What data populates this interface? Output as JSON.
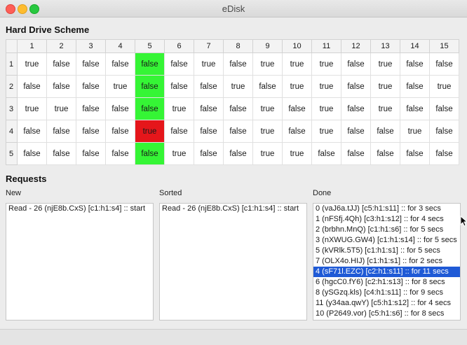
{
  "window": {
    "title": "eDisk"
  },
  "scheme": {
    "title": "Hard Drive Scheme",
    "columns": [
      "1",
      "2",
      "3",
      "4",
      "5",
      "6",
      "7",
      "8",
      "9",
      "10",
      "11",
      "12",
      "13",
      "14",
      "15"
    ],
    "rows": [
      {
        "label": "1",
        "cells": [
          "true",
          "false",
          "false",
          "false",
          "false",
          "false",
          "true",
          "false",
          "true",
          "true",
          "true",
          "false",
          "true",
          "false",
          "false"
        ]
      },
      {
        "label": "2",
        "cells": [
          "false",
          "false",
          "false",
          "true",
          "false",
          "false",
          "false",
          "true",
          "false",
          "true",
          "true",
          "false",
          "true",
          "false",
          "true"
        ]
      },
      {
        "label": "3",
        "cells": [
          "true",
          "true",
          "false",
          "false",
          "false",
          "true",
          "false",
          "false",
          "true",
          "false",
          "true",
          "false",
          "true",
          "false",
          "false"
        ]
      },
      {
        "label": "4",
        "cells": [
          "false",
          "false",
          "false",
          "false",
          "true",
          "false",
          "false",
          "false",
          "true",
          "false",
          "true",
          "false",
          "false",
          "true",
          "false"
        ]
      },
      {
        "label": "5",
        "cells": [
          "false",
          "false",
          "false",
          "false",
          "false",
          "true",
          "false",
          "false",
          "true",
          "true",
          "false",
          "false",
          "false",
          "false",
          "false"
        ]
      }
    ],
    "highlight_column": "5",
    "highlight_red_row": "4",
    "colors": {
      "green": "#35f535",
      "red": "#e5161b",
      "selection": "#1f5ad6"
    }
  },
  "requests": {
    "title": "Requests",
    "new": {
      "label": "New",
      "items": [
        "Read - 26 (njE8b.CxS) [c1:h1:s4] :: start"
      ]
    },
    "sorted": {
      "label": "Sorted",
      "items": [
        "Read - 26 (njE8b.CxS) [c1:h1:s4] :: start"
      ]
    },
    "done": {
      "label": "Done",
      "selected_index": 6,
      "items": [
        "0 (vaJ6a.tJJ) [c5:h1:s11] :: for 3 secs",
        "1 (nFSfj.4Qh) [c3:h1:s12] :: for 4 secs",
        "2 (brbhn.MnQ) [c1:h1:s6] :: for 5 secs",
        "3 (nXWUG.GW4) [c1:h1:s14] :: for 5 secs",
        "5 (kVRlk.5T5) [c1:h1:s1] :: for 5 secs",
        "7 (OLX4o.HIJ) [c1:h1:s1] :: for 2 secs",
        "4 (sF71l.EZC) [c2:h1:s11] :: for 11 secs",
        "6 (hgcC0.fY6) [c2:h1:s13] :: for 8 secs",
        "8 (ySGzq.kls) [c4:h1:s11] :: for 9 secs",
        "11 (y34aa.qwY) [c5:h1:s12] :: for 4 secs",
        "10 (P2649.vor) [c5:h1:s6] :: for 8 secs"
      ]
    }
  }
}
